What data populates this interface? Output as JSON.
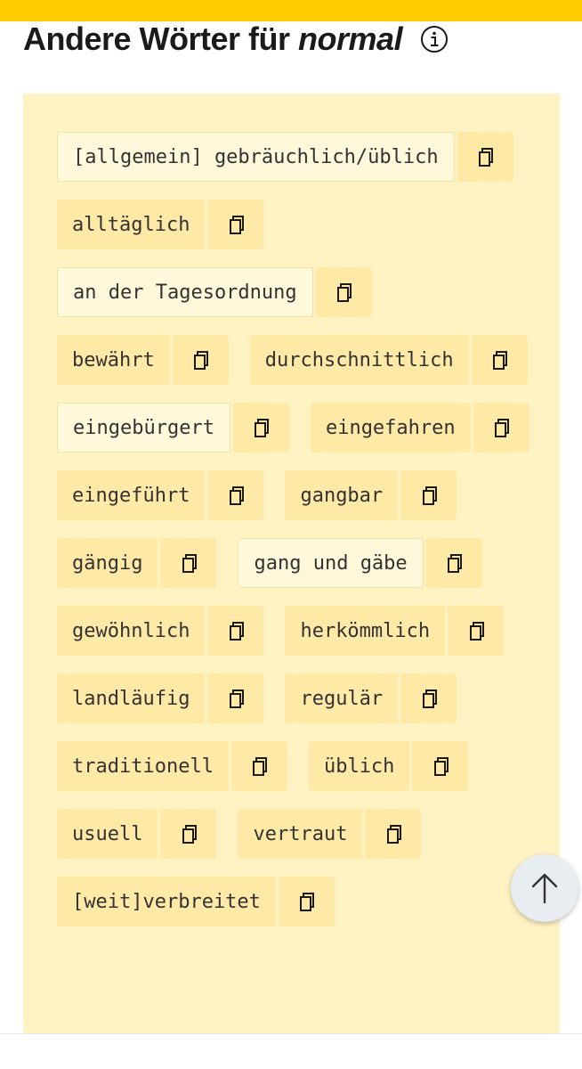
{
  "heading": {
    "prefix": "Andere Wörter für",
    "word": "normal"
  },
  "icons": {
    "info": "info-circle-icon",
    "copy": "copy-icon",
    "scroll_top": "arrow-up-icon"
  },
  "colors": {
    "accent": "#ffcc00",
    "panel_bg": "#fff3c4",
    "chip_bg": "#ffe9a6",
    "chip_bg_light": "#fff8da"
  },
  "synonyms": [
    {
      "text": "[allgemein] gebräuchlich/üblich",
      "style": "light"
    },
    {
      "text": "alltäglich",
      "style": "normal"
    },
    {
      "text": "an der Tagesordnung",
      "style": "light"
    },
    {
      "text": "bewährt",
      "style": "normal"
    },
    {
      "text": "durchschnittlich",
      "style": "normal"
    },
    {
      "text": "eingebürgert",
      "style": "light"
    },
    {
      "text": "eingefahren",
      "style": "normal"
    },
    {
      "text": "eingeführt",
      "style": "normal"
    },
    {
      "text": "gangbar",
      "style": "normal"
    },
    {
      "text": "gängig",
      "style": "normal"
    },
    {
      "text": "gang und gäbe",
      "style": "light"
    },
    {
      "text": "gewöhnlich",
      "style": "normal"
    },
    {
      "text": "herkömmlich",
      "style": "normal"
    },
    {
      "text": "landläufig",
      "style": "normal"
    },
    {
      "text": "regulär",
      "style": "normal"
    },
    {
      "text": "traditionell",
      "style": "normal"
    },
    {
      "text": "üblich",
      "style": "normal"
    },
    {
      "text": "usuell",
      "style": "normal"
    },
    {
      "text": "vertraut",
      "style": "normal"
    },
    {
      "text": "[weit]verbreitet",
      "style": "normal"
    }
  ]
}
